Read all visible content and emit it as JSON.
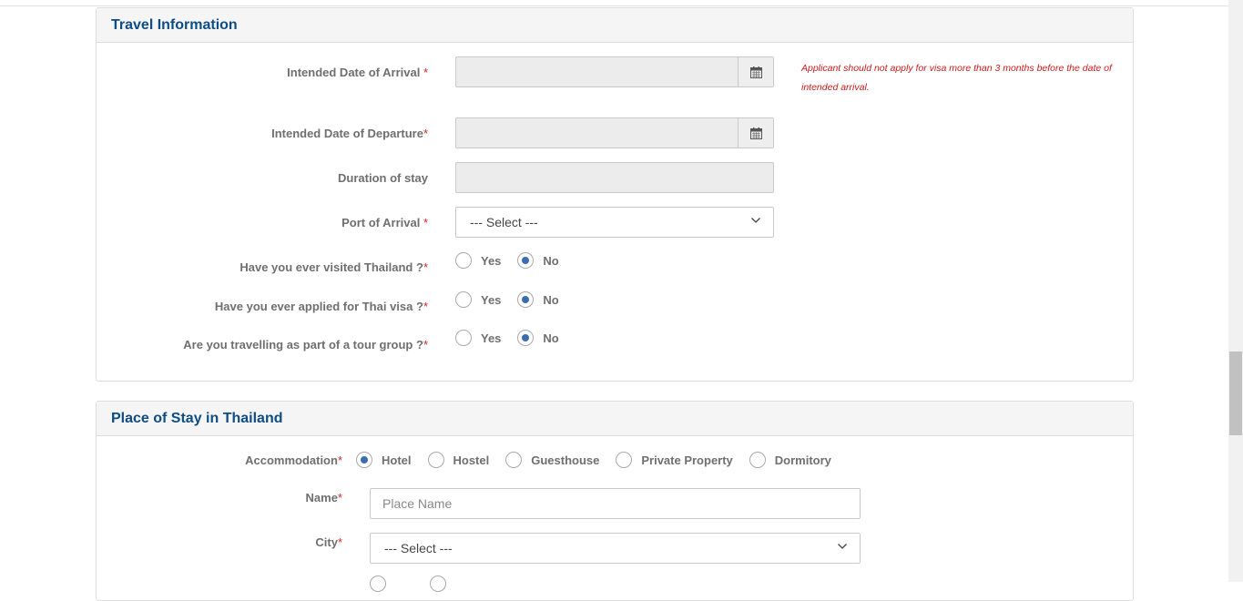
{
  "travel": {
    "title": "Travel Information",
    "arrival_label": "Intended Date of Arrival",
    "departure_label": "Intended Date of Departure",
    "duration_label": "Duration of stay",
    "port_label": "Port of Arrival",
    "port_value": "--- Select ---",
    "visited_label": "Have you ever visited Thailand ?",
    "applied_label": "Have you ever applied for Thai visa ?",
    "tour_label": "Are you travelling as part of a tour group ?",
    "yes": "Yes",
    "no": "No",
    "required_mark": "*",
    "note": "Applicant should not apply for visa more than 3 months before the date of intended arrival.",
    "answers": {
      "visited": "No",
      "applied": "No",
      "tour": "No"
    }
  },
  "stay": {
    "title": "Place of Stay in Thailand",
    "accommodation_label": "Accommodation",
    "options": [
      "Hotel",
      "Hostel",
      "Guesthouse",
      "Private Property",
      "Dormitory"
    ],
    "selected": "Hotel",
    "name_label": "Name",
    "name_placeholder": "Place Name",
    "city_label": "City",
    "city_value": "--- Select ---",
    "required_mark": "*"
  },
  "icons": {
    "calendar": "calendar-icon",
    "chevron": "chevron-down-icon"
  },
  "colors": {
    "title": "#0e4c84",
    "required": "#d9261c",
    "radio_checked": "#3b6db3",
    "note": "#cc1b1b"
  }
}
